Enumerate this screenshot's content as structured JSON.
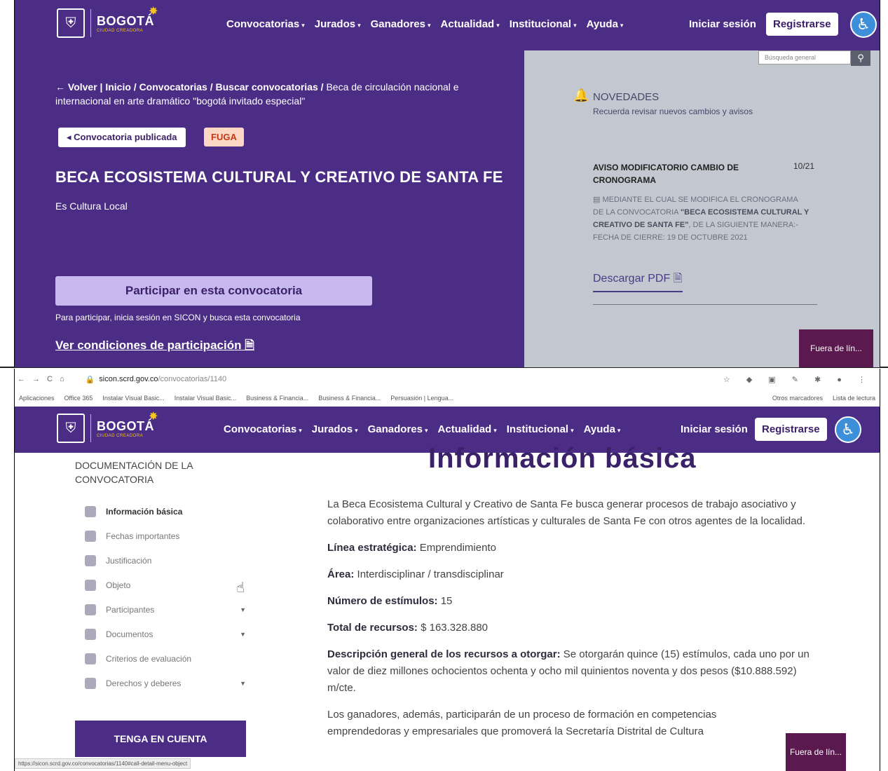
{
  "nav": {
    "logo": "BOGOTÁ",
    "logo_sub": "CIUDAD CREADORA",
    "menu": [
      "Convocatorias",
      "Jurados",
      "Ganadores",
      "Actualidad",
      "Institucional",
      "Ayuda"
    ],
    "login": "Iniciar sesión",
    "register": "Registrarse"
  },
  "top": {
    "breadcrumb_bold": "← Volver | Inicio / Convocatorias / Buscar convocatorias /",
    "breadcrumb_rest": " Beca de circulación nacional e internacional en arte dramático \"bogotá invitado especial\"",
    "badge_published": "◂ Convocatoria publicada",
    "badge_entity": "FUGA",
    "title": "BECA ECOSISTEMA CULTURAL Y CREATIVO DE SANTA FE",
    "subtitle": "Es Cultura Local",
    "participar": "Participar en esta convocatoria",
    "participar_help": "Para participar, inicia sesión en SICON y busca esta convocatoria",
    "conditions_link": "Ver condiciones de participación",
    "search_placeholder": "Búsqueda general",
    "novedades_title": "NOVEDADES",
    "novedades_sub": "Recuerda revisar nuevos cambios y avisos",
    "aviso_title": "AVISO MODIFICATORIO CAMBIO DE CRONOGRAMA",
    "aviso_date": "10/21",
    "aviso_body_1": "MEDIANTE EL CUAL SE MODIFICA EL CRONOGRAMA DE LA CONVOCATORIA ",
    "aviso_body_bold": "\"BECA ECOSISTEMA CULTURAL Y CREATIVO DE SANTA FE\"",
    "aviso_body_2": ", DE LA SIGUIENTE MANERA:- FECHA DE CIERRE: 19 DE OCTUBRE 2021",
    "download": "Descargar PDF",
    "offline": "Fuera de lín..."
  },
  "browser": {
    "url_host": "sicon.scrd.gov.co",
    "url_path": "/convocatorias/1140",
    "bookmarks": [
      "Aplicaciones",
      "Office 365",
      "Instalar Visual Basic...",
      "Instalar Visual Basic...",
      "Business & Financia...",
      "Business & Financia...",
      "Persuasión | Lengua..."
    ],
    "other_bookmarks": "Otros marcadores",
    "reading_list": "Lista de lectura",
    "status_url": "https://sicon.scrd.gov.co/convocatorias/1140#call-detail-menu-object"
  },
  "bottom": {
    "doc_header": "DOCUMENTACIÓN DE LA CONVOCATORIA",
    "section_title": "Información básica",
    "side_items": [
      {
        "label": "Información básica"
      },
      {
        "label": "Fechas importantes"
      },
      {
        "label": "Justificación"
      },
      {
        "label": "Objeto"
      },
      {
        "label": "Participantes"
      },
      {
        "label": "Documentos"
      },
      {
        "label": "Criterios de evaluación"
      },
      {
        "label": "Derechos y deberes"
      }
    ],
    "tenga": "TENGA EN CUENTA",
    "intro": "La Beca Ecosistema Cultural y Creativo de Santa Fe busca generar procesos de trabajo asociativo y colaborativo entre organizaciones artísticas y culturales de Santa Fe con otros agentes de la localidad.",
    "linea_label": "Línea estratégica:",
    "linea_value": " Emprendimiento",
    "area_label": "Área:",
    "area_value": " Interdisciplinar / transdisciplinar",
    "num_label": "Número de estímulos:",
    "num_value": " 15",
    "total_label": "Total de recursos:",
    "total_value": " $ 163.328.880",
    "desc_label": "Descripción general de los recursos a otorgar:",
    "desc_value": " Se otorgarán quince (15) estímulos, cada uno por un valor de diez millones ochocientos ochenta y ocho mil quinientos noventa y dos pesos ($10.888.592) m/cte.",
    "ganadores": "Los ganadores, además, participarán de un proceso de formación en competencias emprendedoras y empresariales que promoverá la Secretaría Distrital de Cultura"
  }
}
